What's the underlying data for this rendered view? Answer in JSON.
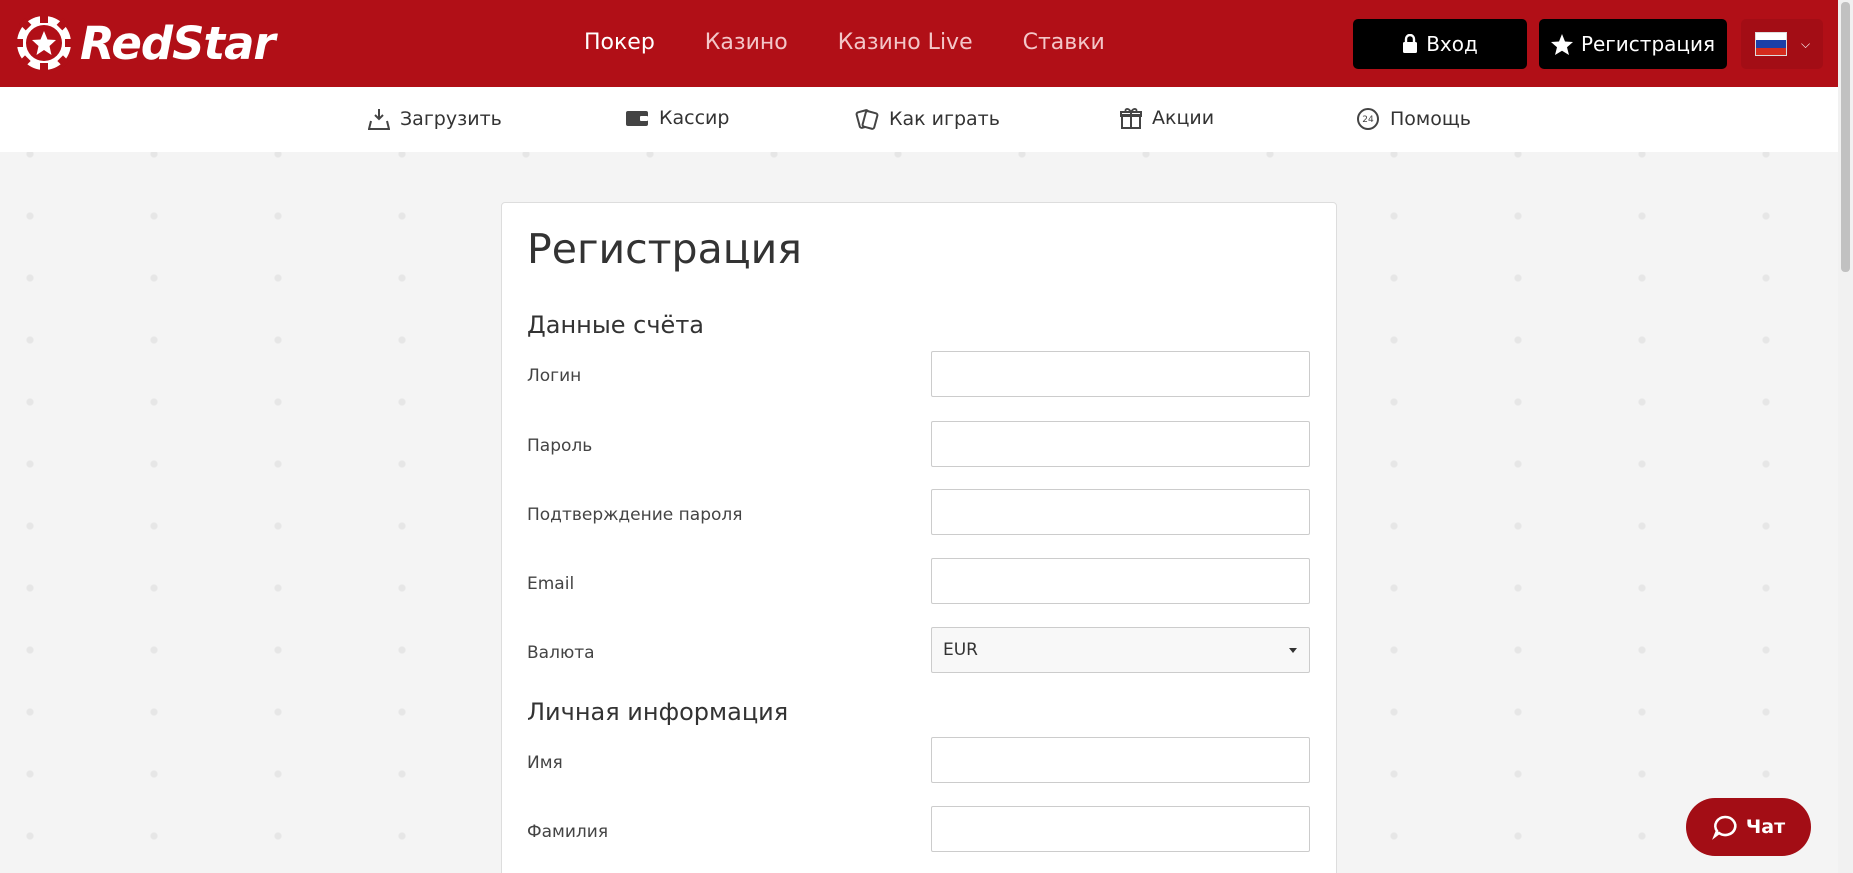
{
  "header": {
    "logo_text": "RedStar",
    "nav": [
      {
        "label": "Покер"
      },
      {
        "label": "Казино"
      },
      {
        "label": "Казино Live"
      },
      {
        "label": "Ставки"
      }
    ],
    "login_label": "Вход",
    "register_label": "Регистрация",
    "language": "ru"
  },
  "subnav": [
    {
      "label": "Загрузить",
      "icon": "download-icon"
    },
    {
      "label": "Кассир",
      "icon": "wallet-icon"
    },
    {
      "label": "Как играть",
      "icon": "cards-icon"
    },
    {
      "label": "Акции",
      "icon": "gift-icon"
    },
    {
      "label": "Помощь",
      "icon": "support-24-icon"
    }
  ],
  "form": {
    "title": "Регистрация",
    "section_account": "Данные счёта",
    "section_personal": "Личная информация",
    "fields": {
      "login": {
        "label": "Логин",
        "value": ""
      },
      "password": {
        "label": "Пароль",
        "value": ""
      },
      "password_confirm": {
        "label": "Подтверждение пароля",
        "value": ""
      },
      "email": {
        "label": "Email",
        "value": ""
      },
      "currency": {
        "label": "Валюта",
        "value": "EUR"
      },
      "first_name": {
        "label": "Имя",
        "value": ""
      },
      "last_name": {
        "label": "Фамилия",
        "value": ""
      }
    }
  },
  "chat": {
    "label": "Чат"
  },
  "colors": {
    "brand_red": "#b10f17",
    "dark_red": "#a30d15",
    "button_black": "#000000"
  }
}
